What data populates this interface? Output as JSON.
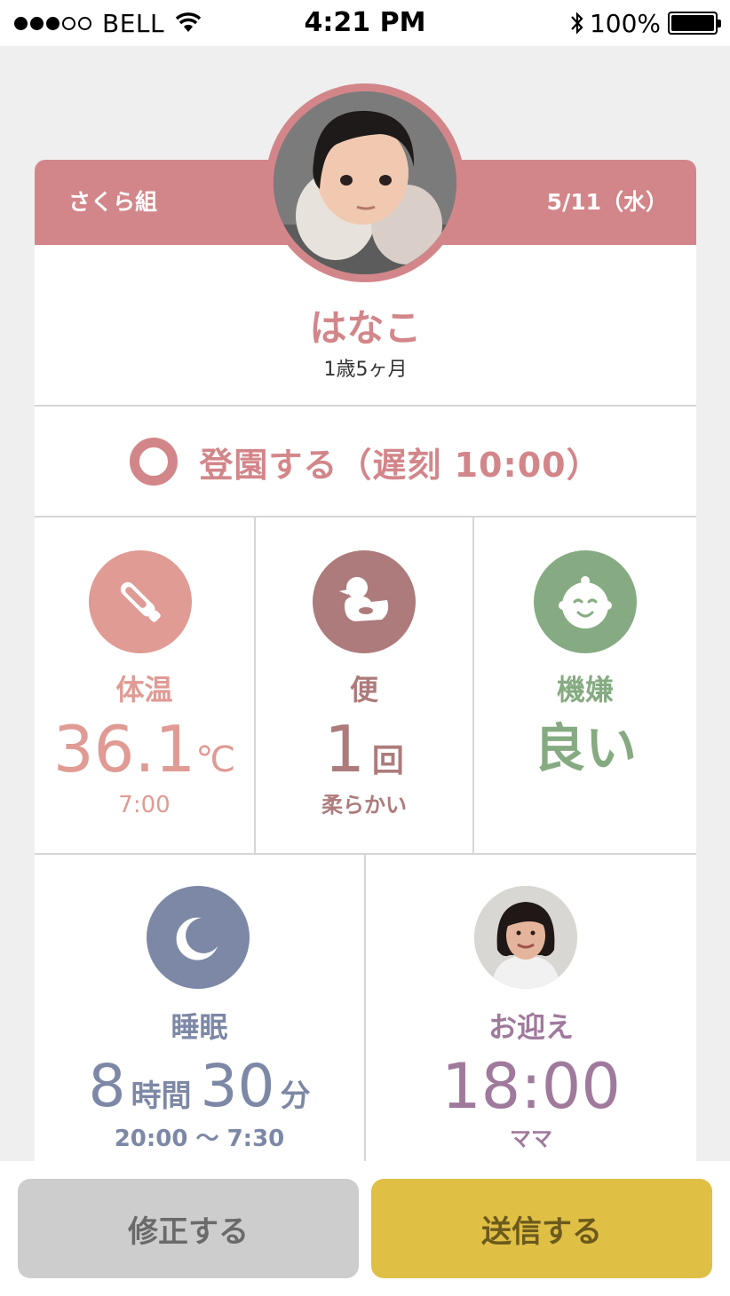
{
  "status_bar": {
    "carrier": "BELL",
    "time": "4:21 PM",
    "battery_percent": "100%",
    "signal_bars": 3,
    "signal_total": 5
  },
  "header": {
    "class_name": "さくら組",
    "date": "5/11（水）"
  },
  "child": {
    "name": "はなこ",
    "age": "1歳5ヶ月"
  },
  "attendance": {
    "label": "登園する（遅刻 10:00）"
  },
  "records": {
    "temperature": {
      "title": "体温",
      "value": "36.1",
      "unit": "℃",
      "time": "7:00",
      "icon": "thermometer-icon",
      "color": "#df9b94"
    },
    "stool": {
      "title": "便",
      "value": "1",
      "unit": "回",
      "note": "柔らかい",
      "icon": "duck-icon",
      "color": "#ad7b7b"
    },
    "mood": {
      "title": "機嫌",
      "value": "良い",
      "icon": "baby-face-icon",
      "color": "#86ab82"
    },
    "sleep": {
      "title": "睡眠",
      "hours": "8",
      "hours_unit": "時間",
      "minutes": "30",
      "minutes_unit": "分",
      "range": "20:00 〜 7:30",
      "icon": "moon-icon",
      "color": "#7d88a6"
    },
    "pickup": {
      "title": "お迎え",
      "time": "18:00",
      "person": "ママ",
      "color": "#a07a9c"
    }
  },
  "buttons": {
    "edit": "修正する",
    "send": "送信する"
  }
}
